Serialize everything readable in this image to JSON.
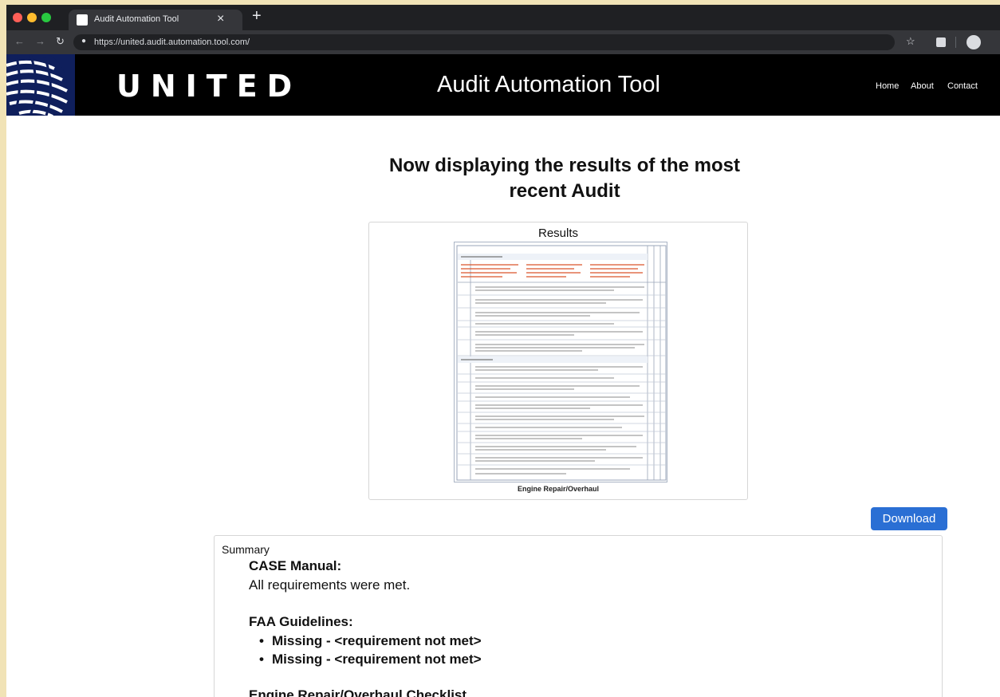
{
  "browser": {
    "tab_title": "Audit Automation Tool",
    "tab_close_glyph": "×",
    "new_tab_glyph": "+",
    "url": "https://united.audit.automation.tool.com/",
    "icons": [
      "back-arrow-icon",
      "forward-arrow-icon",
      "reload-icon",
      "lock-icon",
      "star-icon",
      "extension-icon",
      "profile-avatar-icon"
    ]
  },
  "header": {
    "brand": "UNITED",
    "app_title": "Audit Automation Tool",
    "nav": [
      "Home",
      "About",
      "Contact"
    ]
  },
  "main": {
    "heading_line1": "Now displaying the results of the most",
    "heading_line2": "recent Audit",
    "results": {
      "title": "Results",
      "caption": "Engine Repair/Overhaul"
    },
    "download_label": "Download",
    "summary": {
      "label": "Summary",
      "sections": [
        {
          "title": "CASE Manual:",
          "text": "All requirements were met."
        },
        {
          "title": "FAA Guidelines:",
          "items": [
            "Missing - <requirement not met>",
            "Missing - <requirement not met>"
          ]
        },
        {
          "title": "Engine Repair/Overhaul Checklist"
        }
      ]
    }
  },
  "colors": {
    "header_bg": "#000000",
    "accent_button": "#2a6fd4",
    "logo_blue": "#0f1f5c",
    "checklist_highlight": "#d9542b"
  }
}
